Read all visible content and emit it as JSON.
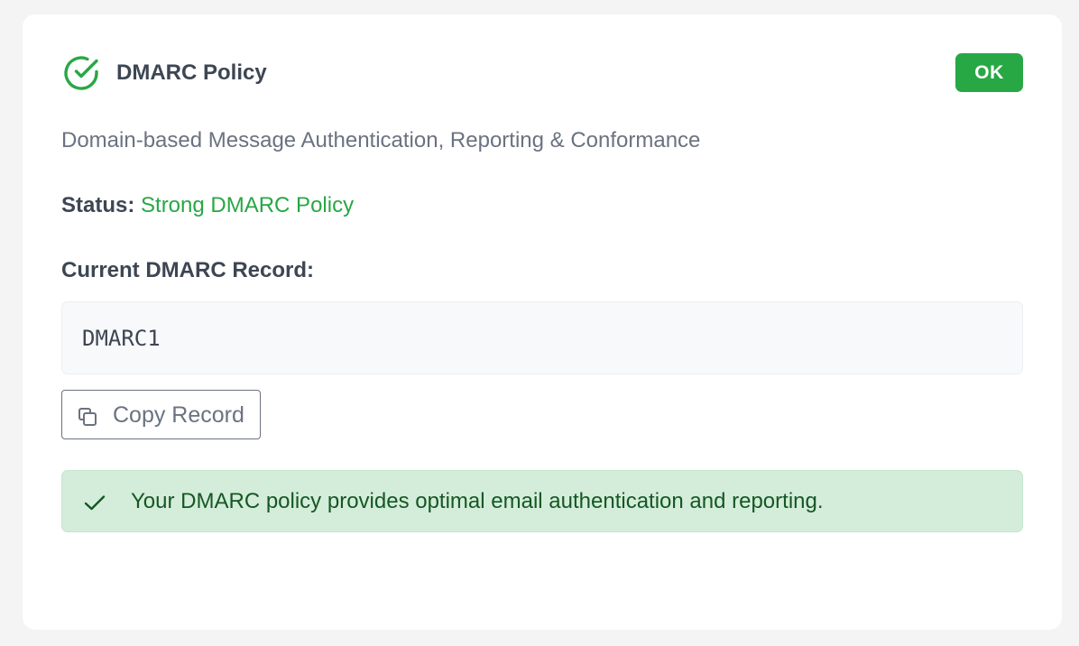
{
  "card": {
    "title": "DMARC Policy",
    "title_icon": "check-circle-icon",
    "badge": "OK",
    "description": "Domain-based Message Authentication, Reporting & Conformance",
    "status_label": "Status:",
    "status_value": "Strong DMARC Policy",
    "record_heading": "Current DMARC Record:",
    "record_value": "DMARC1",
    "copy_button_label": "Copy Record",
    "copy_button_icon": "copy-icon",
    "alert_icon": "check-icon",
    "alert_message": "Your DMARC policy provides optimal email authentication and reporting."
  },
  "colors": {
    "success": "#28a745",
    "alert_background": "#d4edda",
    "alert_text": "#155724",
    "heading_text": "#3d4653",
    "muted_text": "#6b7280"
  }
}
